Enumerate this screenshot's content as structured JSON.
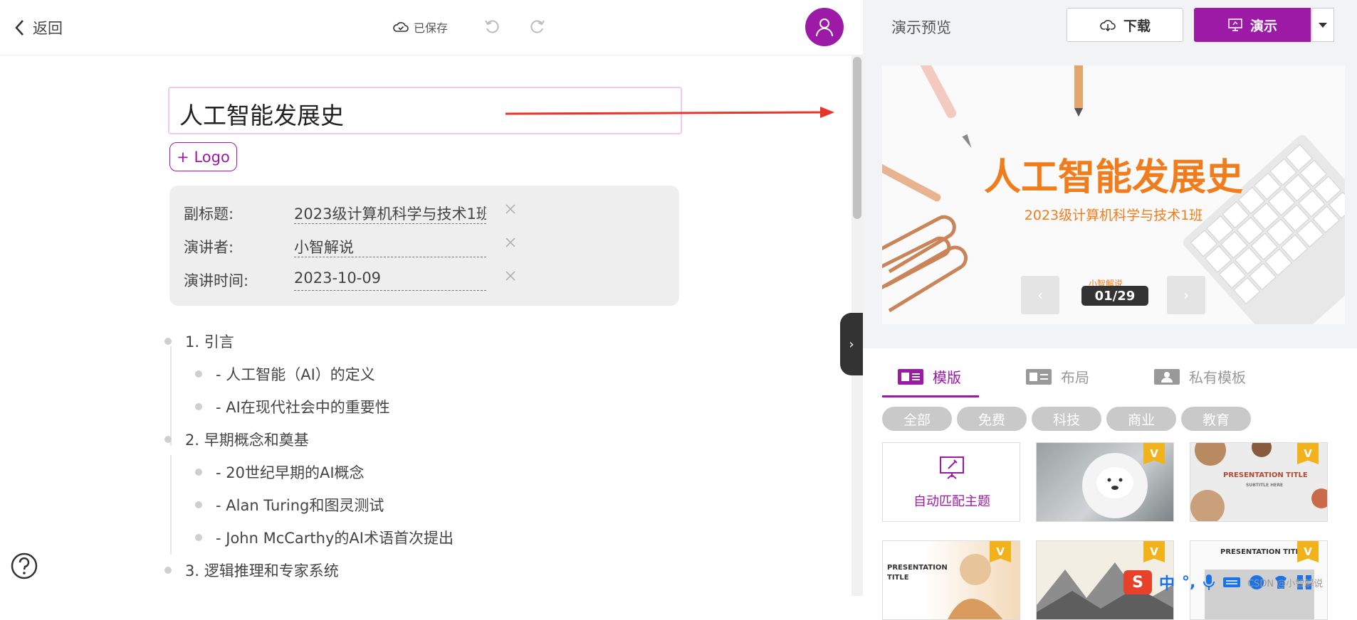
{
  "header": {
    "back_label": "返回",
    "saved_label": "已保存"
  },
  "document": {
    "title": "人工智能发展史",
    "logo_button": "+ Logo",
    "meta": [
      {
        "label": "副标题:",
        "value": "2023级计算机科学与技术1班"
      },
      {
        "label": "演讲者:",
        "value": "小智解说"
      },
      {
        "label": "演讲时间:",
        "value": "2023-10-09"
      }
    ],
    "outline": [
      {
        "text": "1. 引言",
        "level": 1
      },
      {
        "text": "- 人工智能（AI）的定义",
        "level": 2
      },
      {
        "text": "- AI在现代社会中的重要性",
        "level": 2
      },
      {
        "text": "2. 早期概念和奠基",
        "level": 1
      },
      {
        "text": "- 20世纪早期的AI概念",
        "level": 2
      },
      {
        "text": "- Alan Turing和图灵测试",
        "level": 2
      },
      {
        "text": "- John McCarthy的AI术语首次提出",
        "level": 2
      },
      {
        "text": "3. 逻辑推理和专家系统",
        "level": 1
      }
    ]
  },
  "preview": {
    "title": "演示预览",
    "download_label": "下载",
    "present_label": "演示",
    "slide": {
      "title": "人工智能发展史",
      "subtitle": "2023级计算机科学与技术1班",
      "author": "小智解说",
      "page": "01/29"
    },
    "tabs": [
      {
        "label": "模版",
        "active": true
      },
      {
        "label": "布局",
        "active": false
      },
      {
        "label": "私有模板",
        "active": false
      }
    ],
    "filters": [
      "全部",
      "免费",
      "科技",
      "商业",
      "教育"
    ],
    "templates": {
      "auto_label": "自动匹配主题",
      "vip_badge": "V",
      "thumb_texts": {
        "t3_title": "PRESENTATION TITLE",
        "t3_sub": "SUBTITLE HERE",
        "t4_title": "PRESENTATION",
        "t4_title2": "TITLE",
        "t6_title": "PRESENTATION TITLE"
      }
    }
  },
  "taskbar": {
    "ime_label": "S",
    "ime_lang": "中",
    "watermark": "CSDN @小智解说"
  },
  "colors": {
    "accent": "#9c1aa6",
    "slide_orange": "#f07c1b",
    "arrow_red": "#e8352a"
  }
}
